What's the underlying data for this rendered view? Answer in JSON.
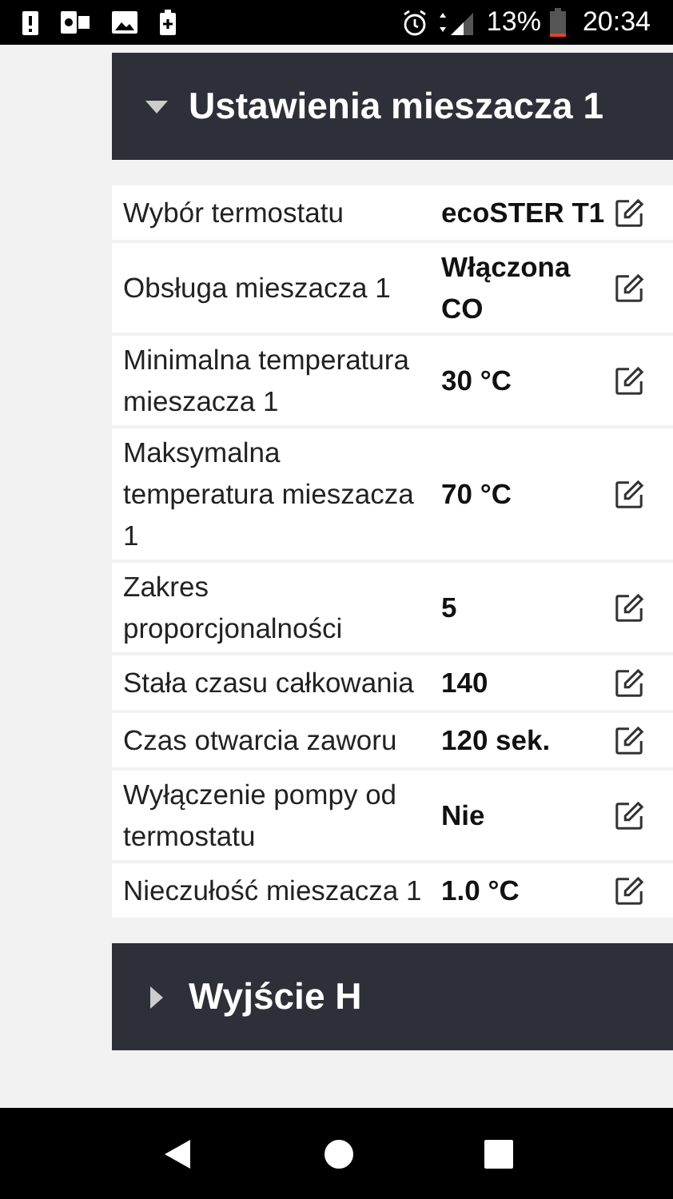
{
  "status_bar": {
    "battery": "13%",
    "time": "20:34"
  },
  "sections": [
    {
      "title": "Ustawienia mieszacza 1",
      "expanded": true,
      "rows": [
        {
          "label": "Wybór termostatu",
          "value": "ecoSTER T1"
        },
        {
          "label": "Obsługa mieszacza 1",
          "value": "Włączona CO"
        },
        {
          "label": "Minimalna temperatura mieszacza 1",
          "value": "30 °C"
        },
        {
          "label": "Maksymalna temperatura mieszacza 1",
          "value": "70 °C"
        },
        {
          "label": "Zakres proporcjonalności",
          "value": "5"
        },
        {
          "label": "Stała czasu całkowania",
          "value": "140"
        },
        {
          "label": "Czas otwarcia zaworu",
          "value": "120 sek."
        },
        {
          "label": "Wyłączenie pompy od termostatu",
          "value": "Nie"
        },
        {
          "label": "Nieczułość mieszacza 1",
          "value": "1.0 °C"
        }
      ]
    },
    {
      "title": "Wyjście H",
      "expanded": false
    }
  ]
}
